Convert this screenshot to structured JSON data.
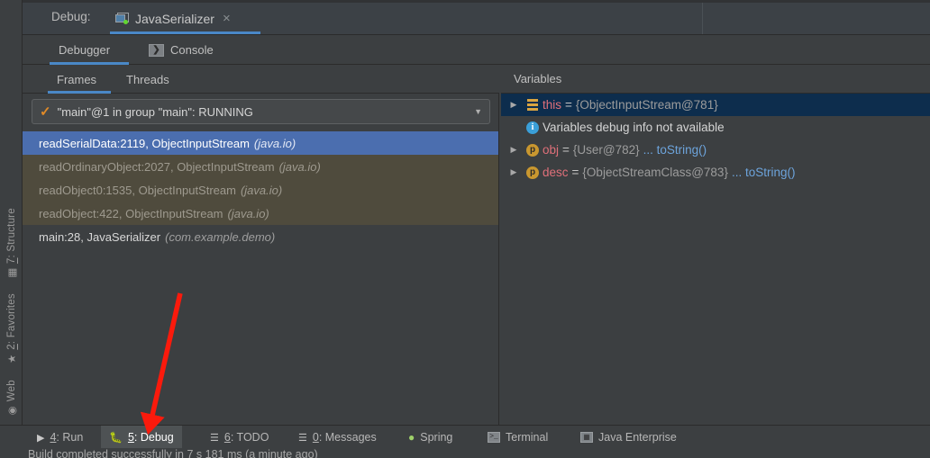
{
  "header": {
    "debug_label": "Debug:",
    "tab": {
      "title": "JavaSerializer",
      "icon": "window-run-icon",
      "close": "×"
    },
    "accent_color": "#4a88c7"
  },
  "tabs_primary": [
    {
      "label": "Debugger",
      "icon": null,
      "active": true
    },
    {
      "label": "Console",
      "icon": "console-icon",
      "active": false
    }
  ],
  "tabs_secondary": [
    {
      "label": "Frames",
      "active": true
    },
    {
      "label": "Threads",
      "active": false
    }
  ],
  "variables_panel": {
    "title": "Variables",
    "rows": [
      {
        "expander": "▶",
        "icon": "field-icon",
        "name": "this",
        "equals": "=",
        "value": "{ObjectInputStream@781}",
        "link": "",
        "selected": true
      },
      {
        "expander": "",
        "icon": "info-icon",
        "name": "",
        "equals": "",
        "plain": "Variables debug info not available",
        "value": "",
        "link": "",
        "selected": false
      },
      {
        "expander": "▶",
        "icon": "parameter-icon",
        "name": "obj",
        "equals": "=",
        "value": "{User@782}",
        "link": "... toString()",
        "selected": false
      },
      {
        "expander": "▶",
        "icon": "parameter-icon",
        "name": "desc",
        "equals": "=",
        "value": "{ObjectStreamClass@783}",
        "link": "... toString()",
        "selected": false
      }
    ]
  },
  "frames_panel": {
    "thread_selector": {
      "icon": "running-check-icon",
      "label": "\"main\"@1 in group \"main\": RUNNING",
      "caret": "▼"
    },
    "frames": [
      {
        "method": "readSerialData:2119, ObjectInputStream",
        "package": "(java.io)",
        "style": "selected"
      },
      {
        "method": "readOrdinaryObject:2027, ObjectInputStream",
        "package": "(java.io)",
        "style": "lib"
      },
      {
        "method": "readObject0:1535, ObjectInputStream",
        "package": "(java.io)",
        "style": "lib"
      },
      {
        "method": "readObject:422, ObjectInputStream",
        "package": "(java.io)",
        "style": "lib"
      },
      {
        "method": "main:28, JavaSerializer",
        "package": "(com.example.demo)",
        "style": "app"
      }
    ]
  },
  "left_toolbar": [
    {
      "label": "7: Structure",
      "key": "7",
      "rest": ": Structure",
      "icon": "structure-icon"
    },
    {
      "label": "2: Favorites",
      "key": "2",
      "rest": ": Favorites",
      "icon": "star-icon"
    },
    {
      "label": "Web",
      "key": "",
      "rest": "Web",
      "icon": "web-icon"
    }
  ],
  "bottom_toolbar": [
    {
      "key": "4",
      "rest": ": Run",
      "icon": "play-icon",
      "active": false
    },
    {
      "key": "5",
      "rest": ": Debug",
      "icon": "bug-icon",
      "active": true
    },
    {
      "key": "6",
      "rest": ": TODO",
      "icon": "list-icon",
      "active": false
    },
    {
      "key": "0",
      "rest": ": Messages",
      "icon": "messages-icon",
      "active": false
    },
    {
      "key": "",
      "rest": "Spring",
      "icon": "spring-leaf-icon",
      "active": false
    },
    {
      "key": "",
      "rest": "Terminal",
      "icon": "terminal-icon",
      "active": false
    },
    {
      "key": "",
      "rest": "Java Enterprise",
      "icon": "java-enterprise-icon",
      "active": false
    }
  ],
  "status_bar": {
    "text": "Build completed successfully in 7 s 181 ms (a minute ago)"
  },
  "annotation": {
    "type": "arrow",
    "color": "#fb1a0c",
    "points": "from (200,325) to (165,478)",
    "target": "debug-tool-window-button"
  }
}
